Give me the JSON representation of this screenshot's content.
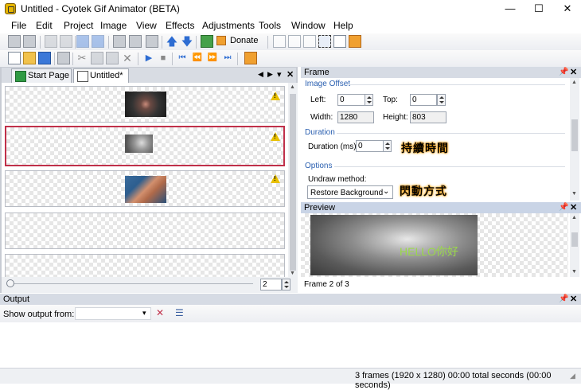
{
  "window": {
    "title": "Untitled - Cyotek Gif Animator (BETA)",
    "minimize": "—",
    "maximize": "☐",
    "close": "✕"
  },
  "menu": [
    "File",
    "Edit",
    "Project",
    "Image",
    "View",
    "Effects",
    "Adjustments",
    "Tools",
    "Window",
    "Help"
  ],
  "toolbar": {
    "donate_label": "Donate"
  },
  "tabs": [
    {
      "label": "Start Page"
    },
    {
      "label": "Untitled*"
    }
  ],
  "tab_controls": {
    "prev": "◀",
    "next": "▶",
    "menu": "▾",
    "close": "✕"
  },
  "frame_list": {
    "zoom_value": "2"
  },
  "frame_panel": {
    "title": "Frame",
    "image_offset": {
      "title": "Image Offset",
      "left_label": "Left:",
      "left_value": "0",
      "top_label": "Top:",
      "top_value": "0",
      "width_label": "Width:",
      "width_value": "1280",
      "height_label": "Height:",
      "height_value": "803"
    },
    "duration": {
      "title": "Duration",
      "label": "Duration (ms):",
      "value": "0",
      "annotation": "持續時間"
    },
    "options": {
      "title": "Options",
      "undraw_label": "Undraw method:",
      "undraw_value": "Restore Background",
      "annotation": "閃動方式"
    }
  },
  "preview_panel": {
    "title": "Preview",
    "overlay_text": "HELLO你好",
    "frame_status": "Frame 2 of 3"
  },
  "output_panel": {
    "title": "Output",
    "show_output_label": "Show output from:"
  },
  "statusbar": {
    "text": "3 frames (1920 x 1280)  00:00 total seconds (00:00 seconds)"
  },
  "colors": {
    "selection": "#c0304a",
    "section_title": "#2a5fb0",
    "annotation_glow": "#ffa000"
  }
}
